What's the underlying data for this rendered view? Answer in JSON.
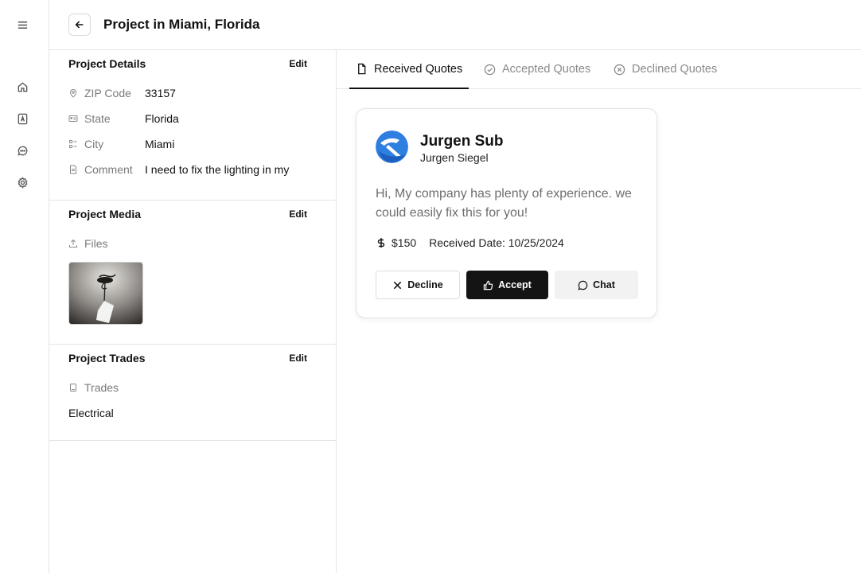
{
  "header": {
    "title": "Project in Miami, Florida"
  },
  "rail": {
    "icons": [
      "menu-icon",
      "home-icon",
      "contacts-icon",
      "messages-icon",
      "settings-icon"
    ]
  },
  "details": {
    "project_details": {
      "title": "Project Details",
      "edit": "Edit",
      "rows": [
        {
          "icon": "location-pin-icon",
          "label": "ZIP Code",
          "value": "33157"
        },
        {
          "icon": "id-card-icon",
          "label": "State",
          "value": "Florida"
        },
        {
          "icon": "list-icon",
          "label": "City",
          "value": "Miami"
        },
        {
          "icon": "document-icon",
          "label": "Comment",
          "value": "I need to fix the lighting in my"
        }
      ]
    },
    "project_media": {
      "title": "Project Media",
      "edit": "Edit",
      "files_label": "Files"
    },
    "project_trades": {
      "title": "Project Trades",
      "edit": "Edit",
      "trades_label": "Trades",
      "trade": "Electrical"
    }
  },
  "tabs": [
    {
      "label": "Received Quotes",
      "active": true
    },
    {
      "label": "Accepted Quotes",
      "active": false
    },
    {
      "label": "Declined Quotes",
      "active": false
    }
  ],
  "quote": {
    "company": "Jurgen Sub",
    "person": "Jurgen Siegel",
    "message": "Hi, My company has plenty of experience. we could easily fix this for you!",
    "price": "$150",
    "received": "Received Date: 10/25/2024",
    "decline": "Decline",
    "accept": "Accept",
    "chat": "Chat"
  },
  "colors": {
    "primary": "#141414",
    "muted": "#7a7a7a",
    "border": "#e5e5e5",
    "avatar_blue": "#2f7fe0"
  }
}
